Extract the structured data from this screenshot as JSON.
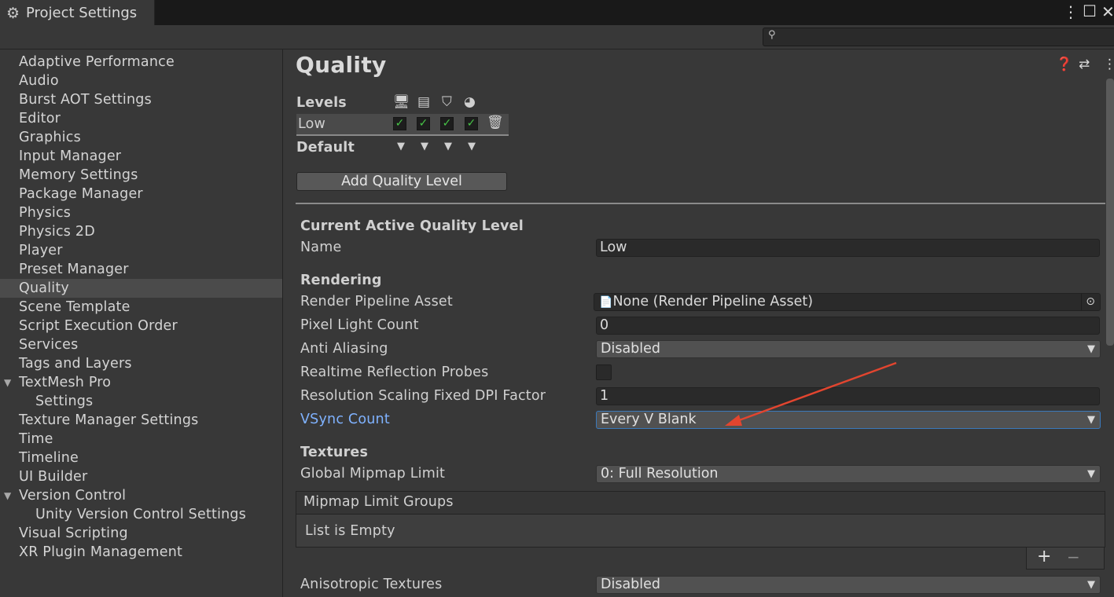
{
  "window": {
    "title": "Project Settings",
    "search_placeholder": ""
  },
  "sidebar": {
    "items": [
      {
        "label": "Adaptive Performance"
      },
      {
        "label": "Audio"
      },
      {
        "label": "Burst AOT Settings"
      },
      {
        "label": "Editor"
      },
      {
        "label": "Graphics"
      },
      {
        "label": "Input Manager"
      },
      {
        "label": "Memory Settings"
      },
      {
        "label": "Package Manager"
      },
      {
        "label": "Physics"
      },
      {
        "label": "Physics 2D"
      },
      {
        "label": "Player"
      },
      {
        "label": "Preset Manager"
      },
      {
        "label": "Quality",
        "selected": true
      },
      {
        "label": "Scene Template"
      },
      {
        "label": "Script Execution Order"
      },
      {
        "label": "Services"
      },
      {
        "label": "Tags and Layers"
      },
      {
        "label": "TextMesh Pro",
        "expanded": true
      },
      {
        "label": "Settings",
        "child": true
      },
      {
        "label": "Texture Manager Settings"
      },
      {
        "label": "Time"
      },
      {
        "label": "Timeline"
      },
      {
        "label": "UI Builder"
      },
      {
        "label": "Version Control",
        "expanded": true
      },
      {
        "label": "Unity Version Control Settings",
        "child": true
      },
      {
        "label": "Visual Scripting"
      },
      {
        "label": "XR Plugin Management"
      }
    ]
  },
  "main": {
    "title": "Quality",
    "levels": {
      "header": "Levels",
      "platform_icons": [
        "desktop-icon",
        "server-icon",
        "html5-icon",
        "console-icon"
      ],
      "rows": [
        {
          "name": "Low",
          "checked": [
            true,
            true,
            true,
            true
          ]
        }
      ],
      "default_label": "Default",
      "add_button": "Add Quality Level"
    },
    "current_section": "Current Active Quality Level",
    "name_label": "Name",
    "name_value": "Low",
    "rendering": {
      "header": "Rendering",
      "render_pipeline_label": "Render Pipeline Asset",
      "render_pipeline_value": "None (Render Pipeline Asset)",
      "pixel_light_label": "Pixel Light Count",
      "pixel_light_value": "0",
      "anti_aliasing_label": "Anti Aliasing",
      "anti_aliasing_value": "Disabled",
      "reflection_probes_label": "Realtime Reflection Probes",
      "reflection_probes_checked": false,
      "dpi_label": "Resolution Scaling Fixed DPI Factor",
      "dpi_value": "1",
      "vsync_label": "VSync Count",
      "vsync_value": "Every V Blank"
    },
    "textures": {
      "header": "Textures",
      "mipmap_limit_label": "Global Mipmap Limit",
      "mipmap_limit_value": "0: Full Resolution",
      "mipmap_groups_header": "Mipmap Limit Groups",
      "mipmap_groups_empty": "List is Empty",
      "add_symbol": "+",
      "remove_symbol": "−",
      "anisotropic_label": "Anisotropic Textures",
      "anisotropic_value": "Disabled"
    }
  },
  "colors": {
    "accent_link": "#7fb2ff",
    "annotation_arrow": "#e2452f",
    "check_green": "#47c447"
  }
}
